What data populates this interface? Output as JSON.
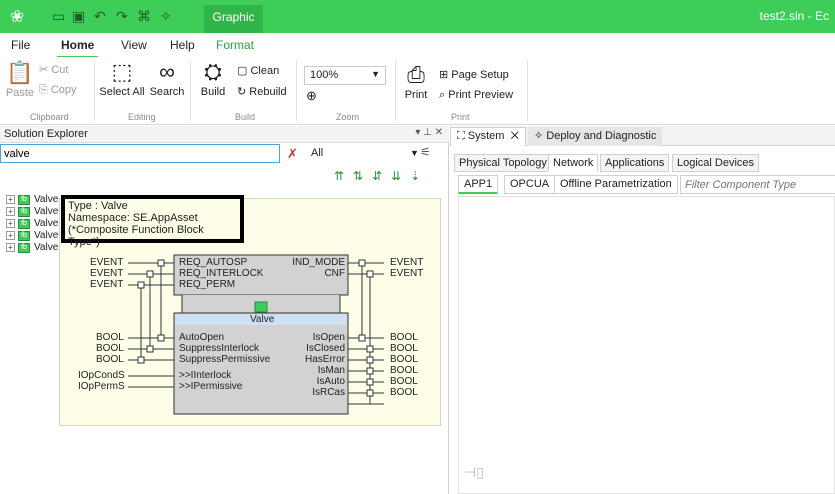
{
  "titlebar": {
    "active_context_tab": "Graphic",
    "window_title": "test2.sln - Ec"
  },
  "menu": {
    "file": "File",
    "home": "Home",
    "view": "View",
    "help": "Help",
    "format": "Format"
  },
  "ribbon": {
    "cut": "Cut",
    "copy": "Copy",
    "paste": "Paste",
    "clipboard": "Clipboard",
    "select_all": "Select All",
    "search": "Search",
    "editing": "Editing",
    "clean": "Clean",
    "rebuild": "Rebuild",
    "build": "Build",
    "build_group": "Build",
    "zoom_value": "100%",
    "zoom_group": "Zoom",
    "page_setup": "Page Setup",
    "print_preview": "Print Preview",
    "print": "Print",
    "print_group": "Print"
  },
  "solution_explorer": {
    "title": "Solution Explorer",
    "header_controls": "▾ ⊥ ✕",
    "search_value": "valve",
    "scope": "All",
    "tree_items": [
      "Valve",
      "Valve",
      "Valve",
      "Valve",
      "Valve"
    ]
  },
  "tooltip": {
    "type_line": "Type   : Valve",
    "namespace_line": "Namespace: SE.AppAsset",
    "kind_line": "(*Composite Function Block Type*)",
    "block_name": "Valve",
    "event_inputs": [
      {
        "type": "EVENT",
        "pin": "REQ_AUTOSP"
      },
      {
        "type": "EVENT",
        "pin": "REQ_INTERLOCK"
      },
      {
        "type": "EVENT",
        "pin": "REQ_PERM"
      }
    ],
    "event_outputs": [
      {
        "type": "EVENT",
        "pin": "IND_MODE"
      },
      {
        "type": "EVENT",
        "pin": "CNF"
      }
    ],
    "data_inputs": [
      {
        "type": "BOOL",
        "pin": "AutoOpen"
      },
      {
        "type": "BOOL",
        "pin": "SuppressInterlock"
      },
      {
        "type": "BOOL",
        "pin": "SuppressPermissive"
      },
      {
        "type": "IOpCondS",
        "pin": ">>IInterlock"
      },
      {
        "type": "IOpPermS",
        "pin": ">>IPermissive"
      }
    ],
    "data_outputs": [
      {
        "type": "BOOL",
        "pin": "IsOpen"
      },
      {
        "type": "BOOL",
        "pin": "IsClosed"
      },
      {
        "type": "BOOL",
        "pin": "HasError"
      },
      {
        "type": "BOOL",
        "pin": "IsMan"
      },
      {
        "type": "BOOL",
        "pin": "IsAuto"
      },
      {
        "type": "BOOL",
        "pin": "IsRCas"
      }
    ]
  },
  "right_panel": {
    "doc_tabs": [
      "System",
      "Deploy and Diagnostic"
    ],
    "sub_tabs": [
      "Physical Topology",
      "Network",
      "Applications",
      "Logical Devices"
    ],
    "toolbar": [
      "APP1",
      "OPCUA",
      "Offline Parametrization"
    ],
    "filter_placeholder": "Filter Component Type"
  },
  "colors": {
    "brand_green": "#3dcd58",
    "tooltip_bg": "#fdfde8",
    "block_body": "#d2d2d2",
    "block_banner": "#cfe0f3"
  }
}
